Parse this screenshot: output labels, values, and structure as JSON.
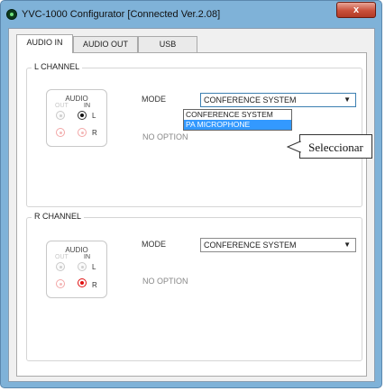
{
  "window": {
    "title": "YVC-1000 Configurator   [Connected  Ver.2.08]",
    "close_glyph": "x"
  },
  "tabs": [
    {
      "label": "AUDIO IN",
      "active": true
    },
    {
      "label": "AUDIO OUT",
      "active": false
    },
    {
      "label": "USB",
      "active": false
    }
  ],
  "l_channel": {
    "group_title": "L CHANNEL",
    "audio_box": {
      "title": "AUDIO",
      "out": "OUT",
      "in": "IN",
      "l": "L",
      "r": "R"
    },
    "mode_label": "MODE",
    "mode_value": "CONFERENCE SYSTEM",
    "no_option": "NO OPTION",
    "dropdown_options": [
      "CONFERENCE SYSTEM",
      "PA MICROPHONE"
    ],
    "dropdown_highlighted": "PA MICROPHONE"
  },
  "r_channel": {
    "group_title": "R CHANNEL",
    "audio_box": {
      "title": "AUDIO",
      "out": "OUT",
      "in": "IN",
      "l": "L",
      "r": "R"
    },
    "mode_label": "MODE",
    "mode_value": "CONFERENCE SYSTEM",
    "no_option": "NO OPTION"
  },
  "callout": {
    "text": "Seleccionar"
  },
  "icons": {
    "dropdown_arrow": "▼",
    "app": "app-icon"
  },
  "colors": {
    "title_bar": "#7fb2d8",
    "close_button": "#c9503b",
    "selection": "#3399ff",
    "selected_radio_red": "#e01010"
  }
}
